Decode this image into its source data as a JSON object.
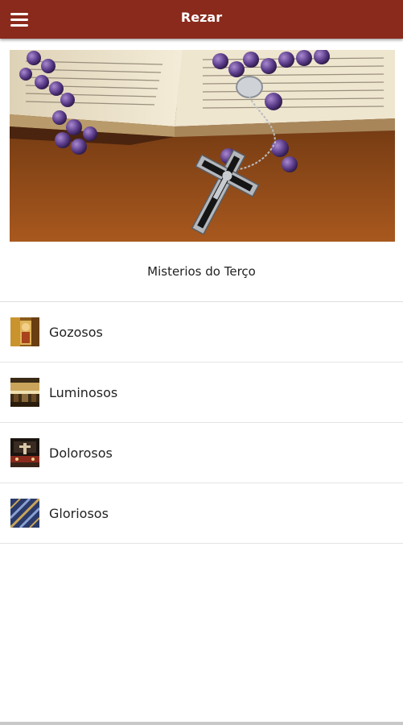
{
  "appbar": {
    "title": "Rezar",
    "menu_icon": "menu-icon",
    "background_color": "#8a2a1c"
  },
  "hero": {
    "image": "rosary-and-open-bible"
  },
  "section": {
    "title": "Misterios do Terço"
  },
  "mysteries": [
    {
      "label": "Gozosos",
      "icon": "gozosos-thumbnail"
    },
    {
      "label": "Luminosos",
      "icon": "luminosos-thumbnail"
    },
    {
      "label": "Dolorosos",
      "icon": "dolorosos-thumbnail"
    },
    {
      "label": "Gloriosos",
      "icon": "gloriosos-thumbnail"
    }
  ]
}
